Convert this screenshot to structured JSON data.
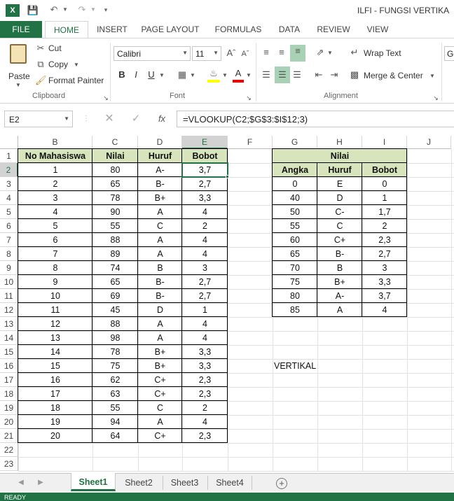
{
  "window": {
    "title": "ILFI - FUNGSI VERTIKA"
  },
  "ribbon_tabs": [
    "FILE",
    "HOME",
    "INSERT",
    "PAGE LAYOUT",
    "FORMULAS",
    "DATA",
    "REVIEW",
    "VIEW"
  ],
  "clipboard": {
    "paste": "Paste",
    "cut": "Cut",
    "copy": "Copy",
    "format_painter": "Format Painter",
    "group": "Clipboard"
  },
  "font": {
    "name": "Calibri",
    "size": "11",
    "group": "Font",
    "bold": "B",
    "italic": "I",
    "underline": "U"
  },
  "alignment": {
    "wrap": "Wrap Text",
    "merge": "Merge & Center",
    "group": "Alignment"
  },
  "number": {
    "format": "Ge"
  },
  "formula_bar": {
    "name_box": "E2",
    "fx": "fx",
    "formula": "=VLOOKUP(C2;$G$3:$I$12;3)"
  },
  "columns": [
    "B",
    "C",
    "D",
    "E",
    "F",
    "G",
    "H",
    "I",
    "J"
  ],
  "rows": [
    "1",
    "2",
    "3",
    "4",
    "5",
    "6",
    "7",
    "8",
    "9",
    "10",
    "11",
    "12",
    "13",
    "14",
    "15",
    "16",
    "17",
    "18",
    "19",
    "20",
    "21",
    "22",
    "23"
  ],
  "main_table": {
    "headers": [
      "No Mahasiswa",
      "Nilai",
      "Huruf",
      "Bobot"
    ],
    "rows": [
      [
        "1",
        "80",
        "A-",
        "3,7"
      ],
      [
        "2",
        "65",
        "B-",
        "2,7"
      ],
      [
        "3",
        "78",
        "B+",
        "3,3"
      ],
      [
        "4",
        "90",
        "A",
        "4"
      ],
      [
        "5",
        "55",
        "C",
        "2"
      ],
      [
        "6",
        "88",
        "A",
        "4"
      ],
      [
        "7",
        "89",
        "A",
        "4"
      ],
      [
        "8",
        "74",
        "B",
        "3"
      ],
      [
        "9",
        "65",
        "B-",
        "2,7"
      ],
      [
        "10",
        "69",
        "B-",
        "2,7"
      ],
      [
        "11",
        "45",
        "D",
        "1"
      ],
      [
        "12",
        "88",
        "A",
        "4"
      ],
      [
        "13",
        "98",
        "A",
        "4"
      ],
      [
        "14",
        "78",
        "B+",
        "3,3"
      ],
      [
        "15",
        "75",
        "B+",
        "3,3"
      ],
      [
        "16",
        "62",
        "C+",
        "2,3"
      ],
      [
        "17",
        "63",
        "C+",
        "2,3"
      ],
      [
        "18",
        "55",
        "C",
        "2"
      ],
      [
        "19",
        "94",
        "A",
        "4"
      ],
      [
        "20",
        "64",
        "C+",
        "2,3"
      ]
    ]
  },
  "lookup_table": {
    "title": "Nilai",
    "headers": [
      "Angka",
      "Huruf",
      "Bobot"
    ],
    "rows": [
      [
        "0",
        "E",
        "0"
      ],
      [
        "40",
        "D",
        "1"
      ],
      [
        "50",
        "C-",
        "1,7"
      ],
      [
        "55",
        "C",
        "2"
      ],
      [
        "60",
        "C+",
        "2,3"
      ],
      [
        "65",
        "B-",
        "2,7"
      ],
      [
        "70",
        "B",
        "3"
      ],
      [
        "75",
        "B+",
        "3,3"
      ],
      [
        "80",
        "A-",
        "3,7"
      ],
      [
        "85",
        "A",
        "4"
      ]
    ]
  },
  "note": "VERTIKAL",
  "sheet_tabs": [
    "Sheet1",
    "Sheet2",
    "Sheet3",
    "Sheet4"
  ],
  "status": "READY",
  "colors": {
    "excel_green": "#217346",
    "header_fill": "#d8e4bc",
    "selected": "#217346"
  }
}
